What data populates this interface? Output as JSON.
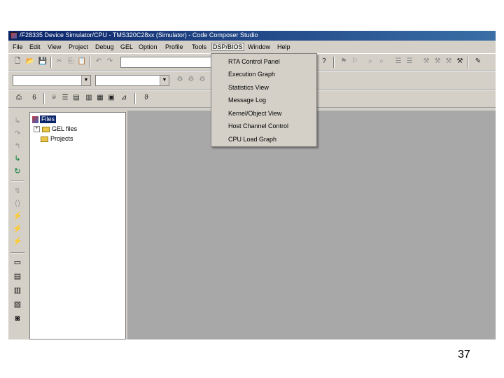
{
  "window": {
    "title": "/F28335 Device Simulator/CPU - TMS320C28xx (Simulator) - Code Composer Studio"
  },
  "menubar": {
    "items": [
      {
        "name": "menu-file",
        "label": "File"
      },
      {
        "name": "menu-edit",
        "label": "Edit"
      },
      {
        "name": "menu-view",
        "label": "View"
      },
      {
        "name": "menu-project",
        "label": "Project"
      },
      {
        "name": "menu-debug",
        "label": "Debug"
      },
      {
        "name": "menu-gel",
        "label": "GEL"
      },
      {
        "name": "menu-option",
        "label": "Option"
      },
      {
        "name": "menu-profile",
        "label": "Profile"
      },
      {
        "name": "menu-tools",
        "label": "Tools"
      },
      {
        "name": "menu-dsp-bios",
        "label": "DSP/BIOS"
      },
      {
        "name": "menu-window",
        "label": "Window"
      },
      {
        "name": "menu-help",
        "label": "Help"
      }
    ]
  },
  "dsp_bios_menu": {
    "items": [
      "RTA Control Panel",
      "Execution Graph",
      "Statistics View",
      "Message Log",
      "Kernel/Object View",
      "Host Channel Control",
      "CPU Load Graph"
    ]
  },
  "project_tree": {
    "root": "Files",
    "children": [
      "GEL files",
      "Projects"
    ]
  },
  "slide": {
    "page_number": "37"
  }
}
